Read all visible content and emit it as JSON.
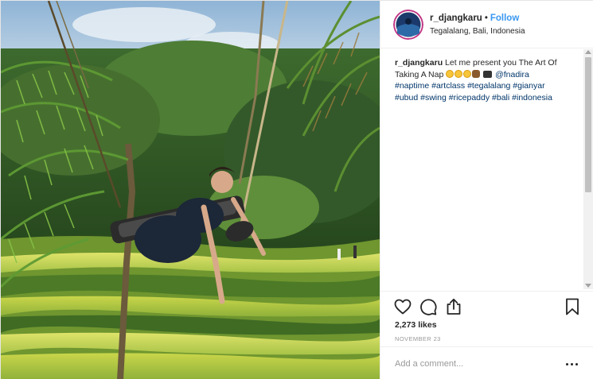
{
  "post": {
    "username": "r_djangkaru",
    "separator": "•",
    "follow_label": "Follow",
    "location": "Tegalalang, Bali, Indonesia",
    "caption": {
      "username": "r_djangkaru",
      "text": "Let me present you The Art Of Taking A Nap",
      "mention": "@fnadira",
      "hashtags": [
        "#naptime",
        "#artclass",
        "#tegalalang",
        "#gianyar",
        "#ubud",
        "#swing",
        "#ricepaddy",
        "#bali",
        "#indonesia"
      ]
    },
    "likes": "2,273 likes",
    "date": "NOVEMBER 23",
    "comment_placeholder": "Add a comment...",
    "icons": {
      "like": "heart-icon",
      "comment": "comment-icon",
      "share": "share-icon",
      "save": "bookmark-icon",
      "more": "more-options-icon"
    }
  },
  "colors": {
    "link_blue": "#3897f0",
    "hashtag_blue": "#003569",
    "muted_gray": "#999999",
    "text": "#262626"
  }
}
